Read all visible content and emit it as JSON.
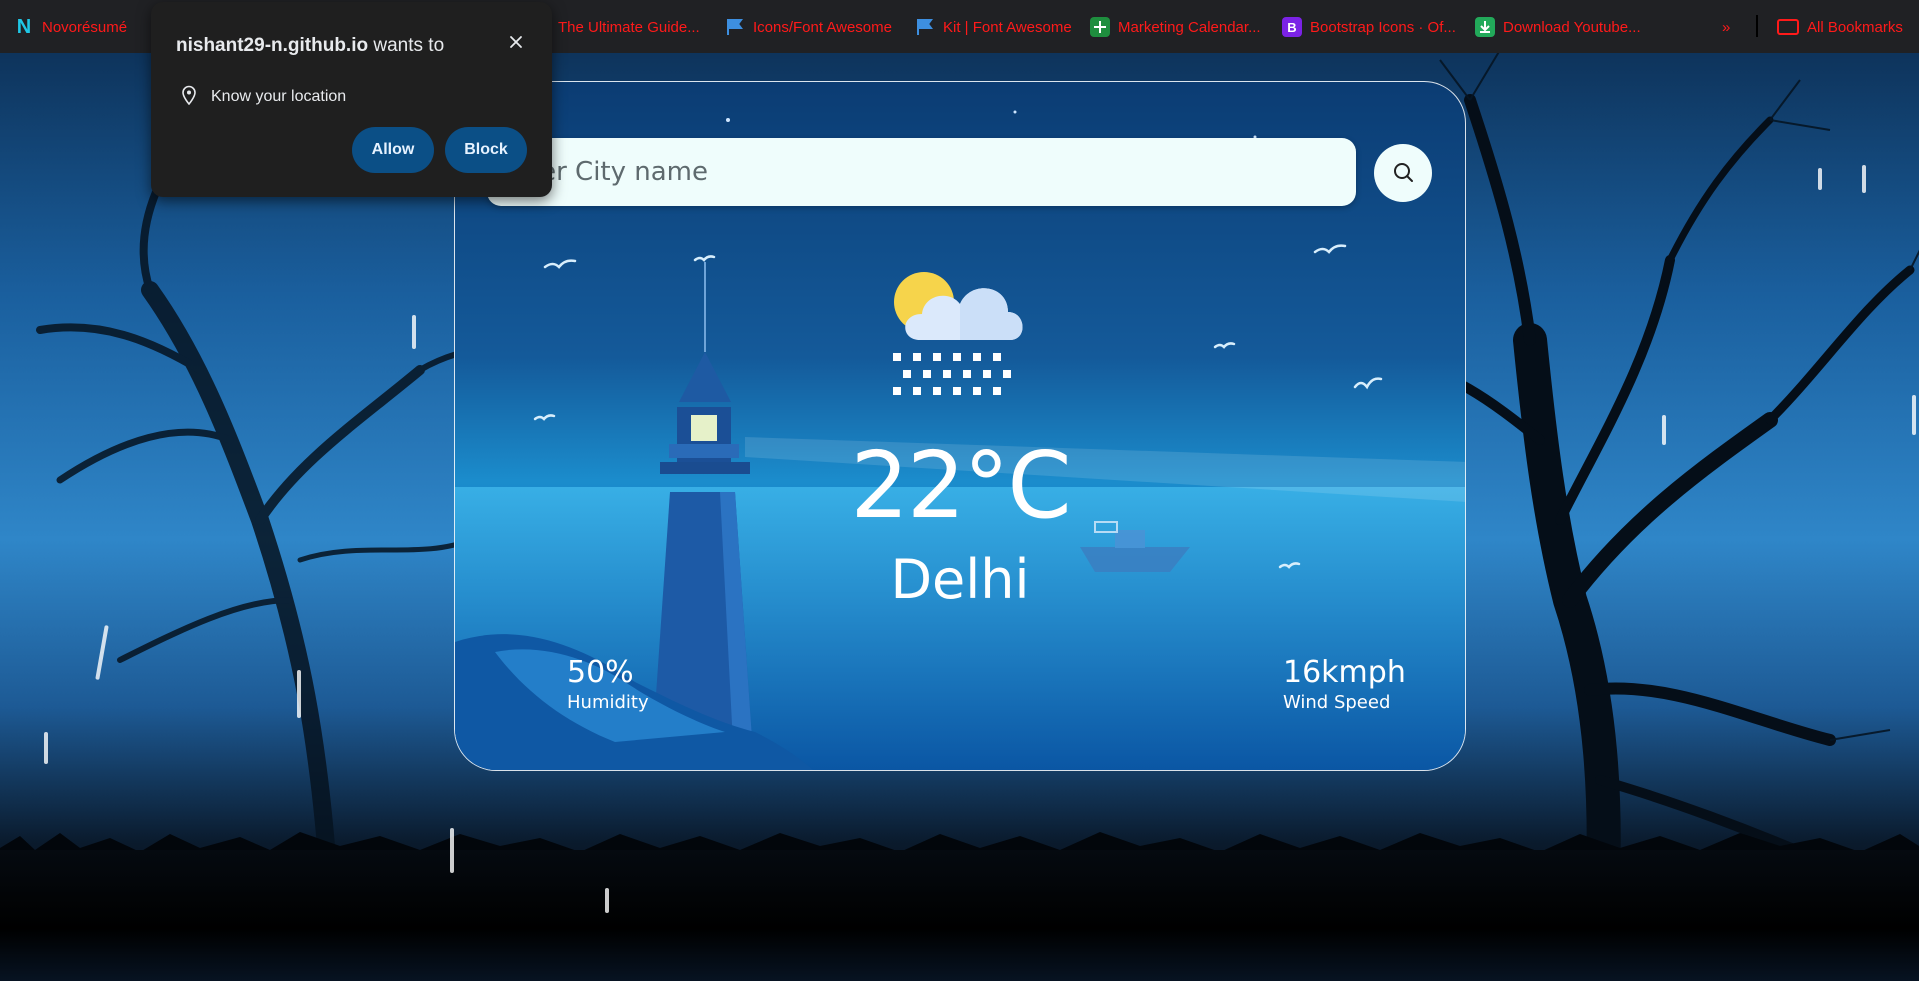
{
  "bookmarks": {
    "items": [
      {
        "label": "Novorésumé",
        "icon": "novoresume-icon"
      },
      {
        "label": "The Ultimate Guide...",
        "icon": "bookmark-icon"
      },
      {
        "label": "Icons/Font Awesome",
        "icon": "font-awesome-flag-icon"
      },
      {
        "label": "Kit | Font Awesome",
        "icon": "font-awesome-flag-icon"
      },
      {
        "label": "Marketing Calendar...",
        "icon": "google-sheets-icon"
      },
      {
        "label": "Bootstrap Icons · Of...",
        "icon": "bootstrap-icon"
      },
      {
        "label": "Download Youtube...",
        "icon": "download-icon"
      }
    ],
    "overflow_label": "»",
    "all_bookmarks_label": "All Bookmarks",
    "bootstrap_glyph": "B"
  },
  "permission_popup": {
    "site": "nishant29-n.github.io",
    "wants_to": "wants to",
    "permission": "Know your location",
    "allow_label": "Allow",
    "block_label": "Block"
  },
  "weather": {
    "search_placeholder": "Enter City name",
    "temperature": "22°C",
    "city": "Delhi",
    "humidity_value": "50%",
    "humidity_label": "Humidity",
    "wind_value": "16kmph",
    "wind_label": "Wind Speed",
    "condition_icon": "cloud-sun-rain-icon"
  },
  "colors": {
    "card_bg": "#145a9a",
    "input_bg": "#effdfc",
    "popup_bg": "#1f1f1f",
    "popup_button": "#0b4f86",
    "bookmark_text": "#ff1a1a"
  }
}
